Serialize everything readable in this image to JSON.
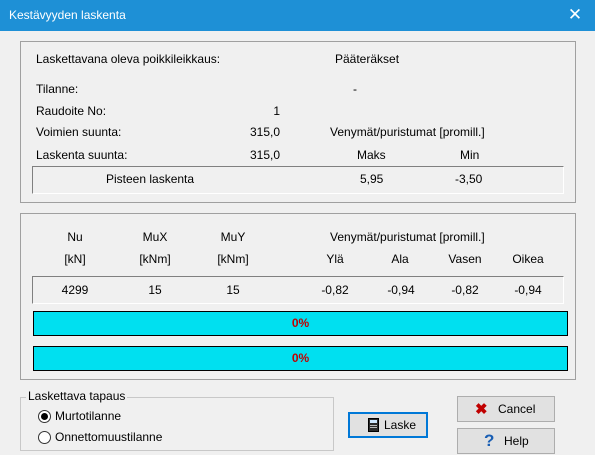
{
  "window": {
    "title": "Kestävyyden laskenta",
    "close_icon": "close-icon",
    "accent": "#1e90d6"
  },
  "info": {
    "section_label": "Laskettavana oleva poikkileikkaus:",
    "section_value": "Pääteräkset",
    "tilanne_label": "Tilanne:",
    "tilanne_value": "-",
    "raudoite_label": "Raudoite No:",
    "raudoite_value": "1",
    "voimien_label": "Voimien suunta:",
    "voimien_value": "315,0",
    "laskenta_label": "Laskenta suunta:",
    "laskenta_value": "315,0",
    "strain_header": "Venymät/puristumat  [promill.]",
    "maks_label": "Maks",
    "min_label": "Min",
    "point_label": "Pisteen laskenta",
    "point_maks": "5,95",
    "point_min": "-3,50"
  },
  "results": {
    "headers": {
      "nu": "Nu",
      "mux": "MuX",
      "muy": "MuY",
      "strain": "Venymät/puristumat  [promill.]"
    },
    "units": {
      "nu": "[kN]",
      "mux": "[kNm]",
      "muy": "[kNm]",
      "yla": "Ylä",
      "ala": "Ala",
      "vasen": "Vasen",
      "oikea": "Oikea"
    },
    "values": {
      "nu": "4299",
      "mux": "15",
      "muy": "15",
      "yla": "-0,82",
      "ala": "-0,94",
      "vasen": "-0,82",
      "oikea": "-0,94"
    },
    "progress1": {
      "label": "0%",
      "fraction": 0
    },
    "progress2": {
      "label": "0%",
      "fraction": 0
    },
    "bar_color": "#00e0f0",
    "bar_text_color": "#c00000"
  },
  "case": {
    "group_label": "Laskettava tapaus",
    "options": [
      "Murtotilanne",
      "Onnettomuustilanne"
    ],
    "selected": "Murtotilanne"
  },
  "buttons": {
    "laske": "Laske",
    "laske_icon": "calculator-icon",
    "cancel": "Cancel",
    "cancel_icon": "red-x-icon",
    "help": "Help",
    "help_icon": "question-mark-icon"
  }
}
